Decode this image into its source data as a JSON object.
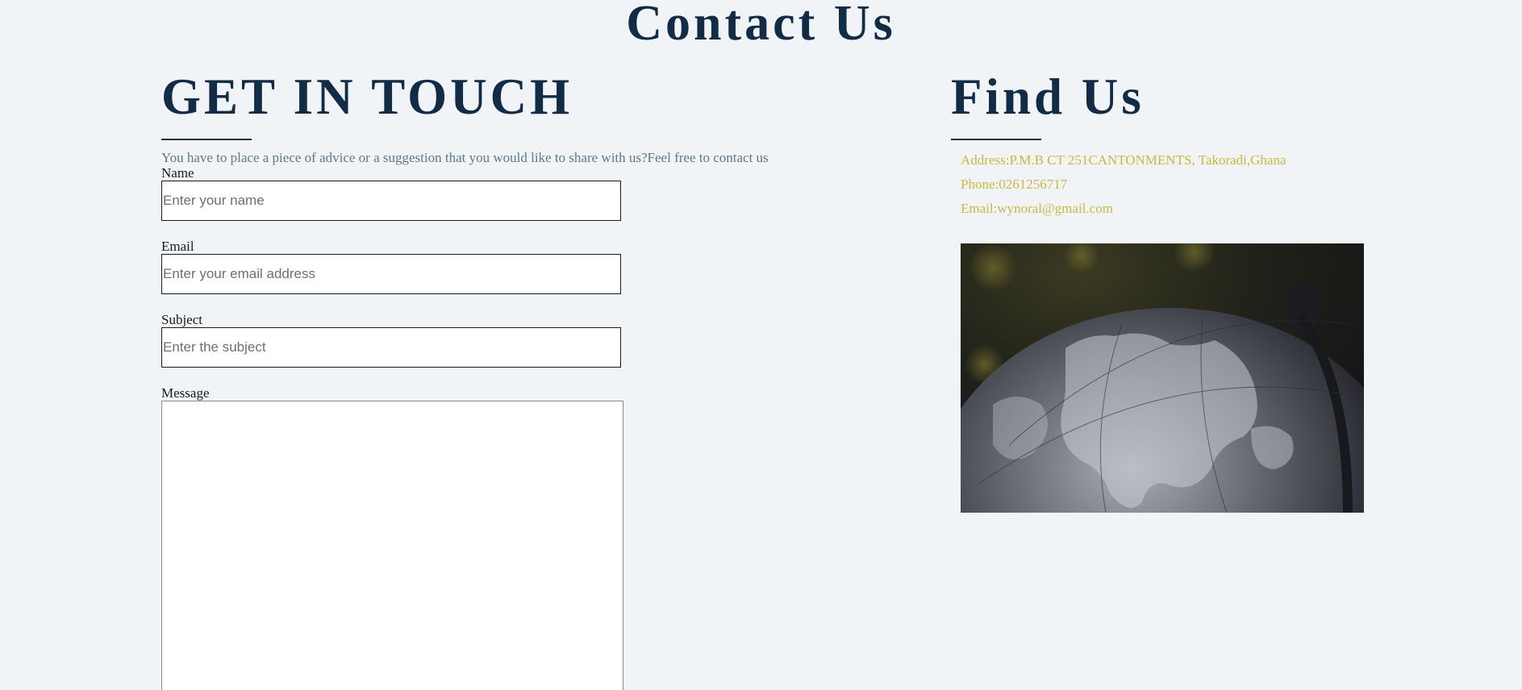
{
  "title": "Contact Us",
  "get_in_touch": {
    "heading": "GET IN TOUCH",
    "intro": "You have to place a piece of advice or a suggestion that you would like to share with us?Feel free to contact us"
  },
  "form": {
    "name_label": "Name",
    "name_placeholder": "Enter your name",
    "email_label": "Email",
    "email_placeholder": "Enter your email address",
    "subject_label": "Subject",
    "subject_placeholder": "Enter the subject",
    "message_label": "Message"
  },
  "find_us": {
    "heading": "Find Us",
    "address": "Address:P.M.B CT 251CANTONMENTS, Takoradi,Ghana",
    "phone": "Phone:0261256717",
    "email": "Email:wynoral@gmail.com"
  },
  "colors": {
    "background": "#f0f4f7",
    "heading": "#122c45",
    "intro_text": "#5d778d",
    "contact_text": "#c9b941"
  }
}
